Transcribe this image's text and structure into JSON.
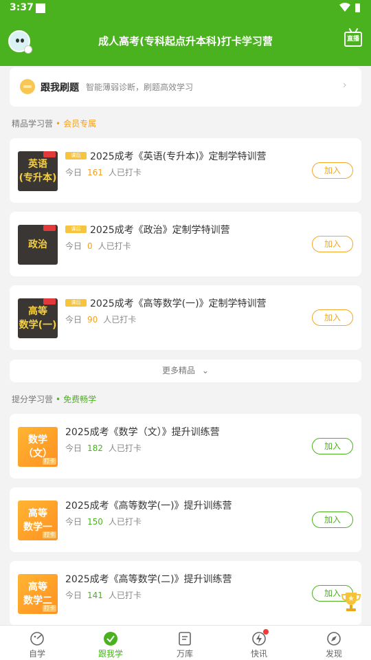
{
  "status_bar": {
    "time": "3:37"
  },
  "app_bar": {
    "title": "成人高考(专科起点升本科)打卡学习营",
    "live_label": "直播"
  },
  "drill": {
    "name": "跟我刷题",
    "desc": "智能薄弱诊断，刷题高效学习"
  },
  "premium_section": {
    "label": "精品学习营",
    "dot": "•",
    "tag": "会员专属"
  },
  "premium_camps": [
    {
      "thumb_line1": "英语",
      "thumb_line2": "(专升本)",
      "badge": "课后",
      "title": "2025成考《英语(专升本)》定制学特训营",
      "today": "今日",
      "count": "161",
      "suffix": "人已打卡",
      "join": "加入"
    },
    {
      "thumb_line1": "政治",
      "thumb_line2": "",
      "badge": "课后",
      "title": "2025成考《政治》定制学特训营",
      "today": "今日",
      "count": "0",
      "suffix": "人已打卡",
      "join": "加入"
    },
    {
      "thumb_line1": "高等",
      "thumb_line2": "数学(一)",
      "badge": "课后",
      "title": "2025成考《高等数学(一)》定制学特训营",
      "today": "今日",
      "count": "90",
      "suffix": "人已打卡",
      "join": "加入"
    }
  ],
  "more": {
    "label": "更多精品"
  },
  "free_section": {
    "label": "提分学习营",
    "dot": "•",
    "tag": "免费畅学"
  },
  "free_camps": [
    {
      "thumb_line1": "数学",
      "thumb_line2": "（文）",
      "stamp": "打卡",
      "title": "2025成考《数学（文）》提升训练营",
      "today": "今日",
      "count": "182",
      "suffix": "人已打卡",
      "join": "加入"
    },
    {
      "thumb_line1": "高等",
      "thumb_line2": "数学一",
      "stamp": "打卡",
      "title": "2025成考《高等数学(一)》提升训练营",
      "today": "今日",
      "count": "150",
      "suffix": "人已打卡",
      "join": "加入"
    },
    {
      "thumb_line1": "高等",
      "thumb_line2": "数学二",
      "stamp": "打卡",
      "title": "2025成考《高等数学(二)》提升训练营",
      "today": "今日",
      "count": "141",
      "suffix": "人已打卡",
      "join": "加入"
    }
  ],
  "tabs": [
    {
      "label": "自学",
      "icon": "self-study-icon"
    },
    {
      "label": "跟我学",
      "icon": "follow-study-icon"
    },
    {
      "label": "万库",
      "icon": "library-icon"
    },
    {
      "label": "快讯",
      "icon": "news-flash-icon"
    },
    {
      "label": "发现",
      "icon": "compass-icon"
    }
  ],
  "colors": {
    "brand_green": "#4ab21f",
    "accent_orange": "#f5a623",
    "background": "#f3f3f3"
  }
}
